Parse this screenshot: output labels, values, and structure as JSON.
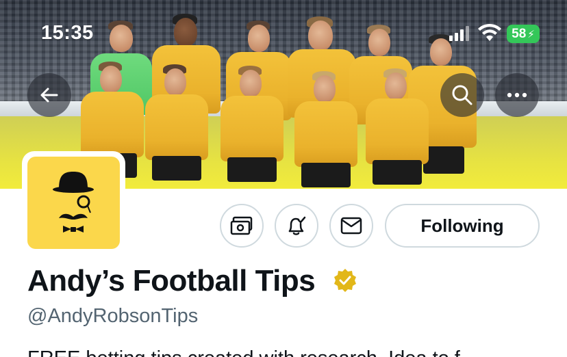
{
  "status_bar": {
    "time": "15:35",
    "battery": "58",
    "battery_color": "#34c759"
  },
  "banner": {
    "description_colors": {
      "shirt": "#f3c23a",
      "keeper_shirt": "#6fdb7e",
      "pitch": "#e6e242"
    }
  },
  "header_actions": {
    "back_icon": "arrow-left-icon",
    "search_icon": "search-icon",
    "more_icon": "more-horizontal-icon"
  },
  "profile": {
    "avatar_icon": "gentleman-logo-icon",
    "avatar_bg": "#fbd74b",
    "display_name": "Andy’s Football Tips",
    "verified_icon": "verified-badge-icon",
    "verified_color": "#e2b719",
    "handle": "@AndyRobsonTips",
    "bio_partial": "FREE betting tips created with research. Idea to f..."
  },
  "actions": {
    "subscriptions_icon": "money-icon",
    "notifications_icon": "bell-check-icon",
    "message_icon": "envelope-icon",
    "following_label": "Following"
  }
}
